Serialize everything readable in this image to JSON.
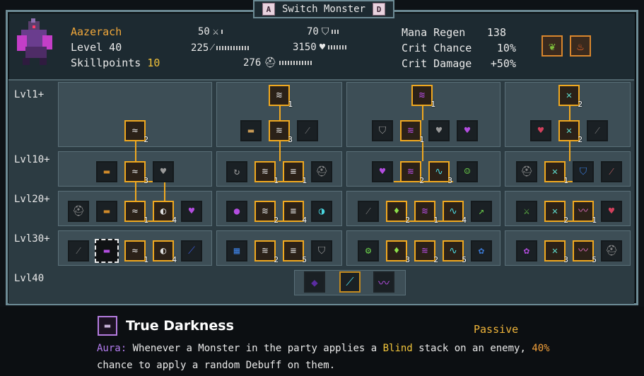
{
  "header_tab": {
    "left_key": "A",
    "title": "Switch Monster",
    "right_key": "D"
  },
  "monster": {
    "name": "Aazerach",
    "level": "Level 40",
    "skillpoints_label": "Skillpoints",
    "skillpoints_value": "10"
  },
  "stats": {
    "attack": "50",
    "defense": "70",
    "magic": "225",
    "resistance": "3150",
    "health": "276",
    "mana_regen_label": "Mana Regen",
    "mana_regen": "138",
    "crit_chance_label": "Crit Chance",
    "crit_chance": "10%",
    "crit_damage_label": "Crit Damage",
    "crit_damage": "+50%"
  },
  "tree": {
    "levels": [
      "Lvl1+",
      "Lvl10+",
      "Lvl20+",
      "Lvl30+",
      "Lvl40"
    ],
    "node_counts": [
      "1",
      "1",
      "2",
      "2",
      "3",
      "1",
      "2",
      "3",
      "1",
      "1",
      "2",
      "3",
      "1",
      "1",
      "4",
      "2",
      "4",
      "2",
      "1",
      "4",
      "2",
      "1",
      "1",
      "4",
      "2",
      "5",
      "3",
      "2",
      "5",
      "3",
      "5",
      "2"
    ]
  },
  "description": {
    "title": "True Darkness",
    "type": "Passive",
    "aura": "Aura:",
    "text_a": " Whenever a Monster in the party applies a ",
    "blind": "Blind",
    "text_b": " stack on an enemy, ",
    "pct": "40%",
    "text_c": "chance to apply a random Debuff on them."
  },
  "colors": {
    "accent": "#f0a81f",
    "frame": "#6d8b95",
    "aura": "#b47cf0",
    "name": "#f2a83a"
  },
  "icons": [
    "sword-icon",
    "shield-icon",
    "magic-wand-icon",
    "heart-icon",
    "helmet-icon",
    "leaf-buff-icon",
    "fire-shield-buff-icon"
  ]
}
